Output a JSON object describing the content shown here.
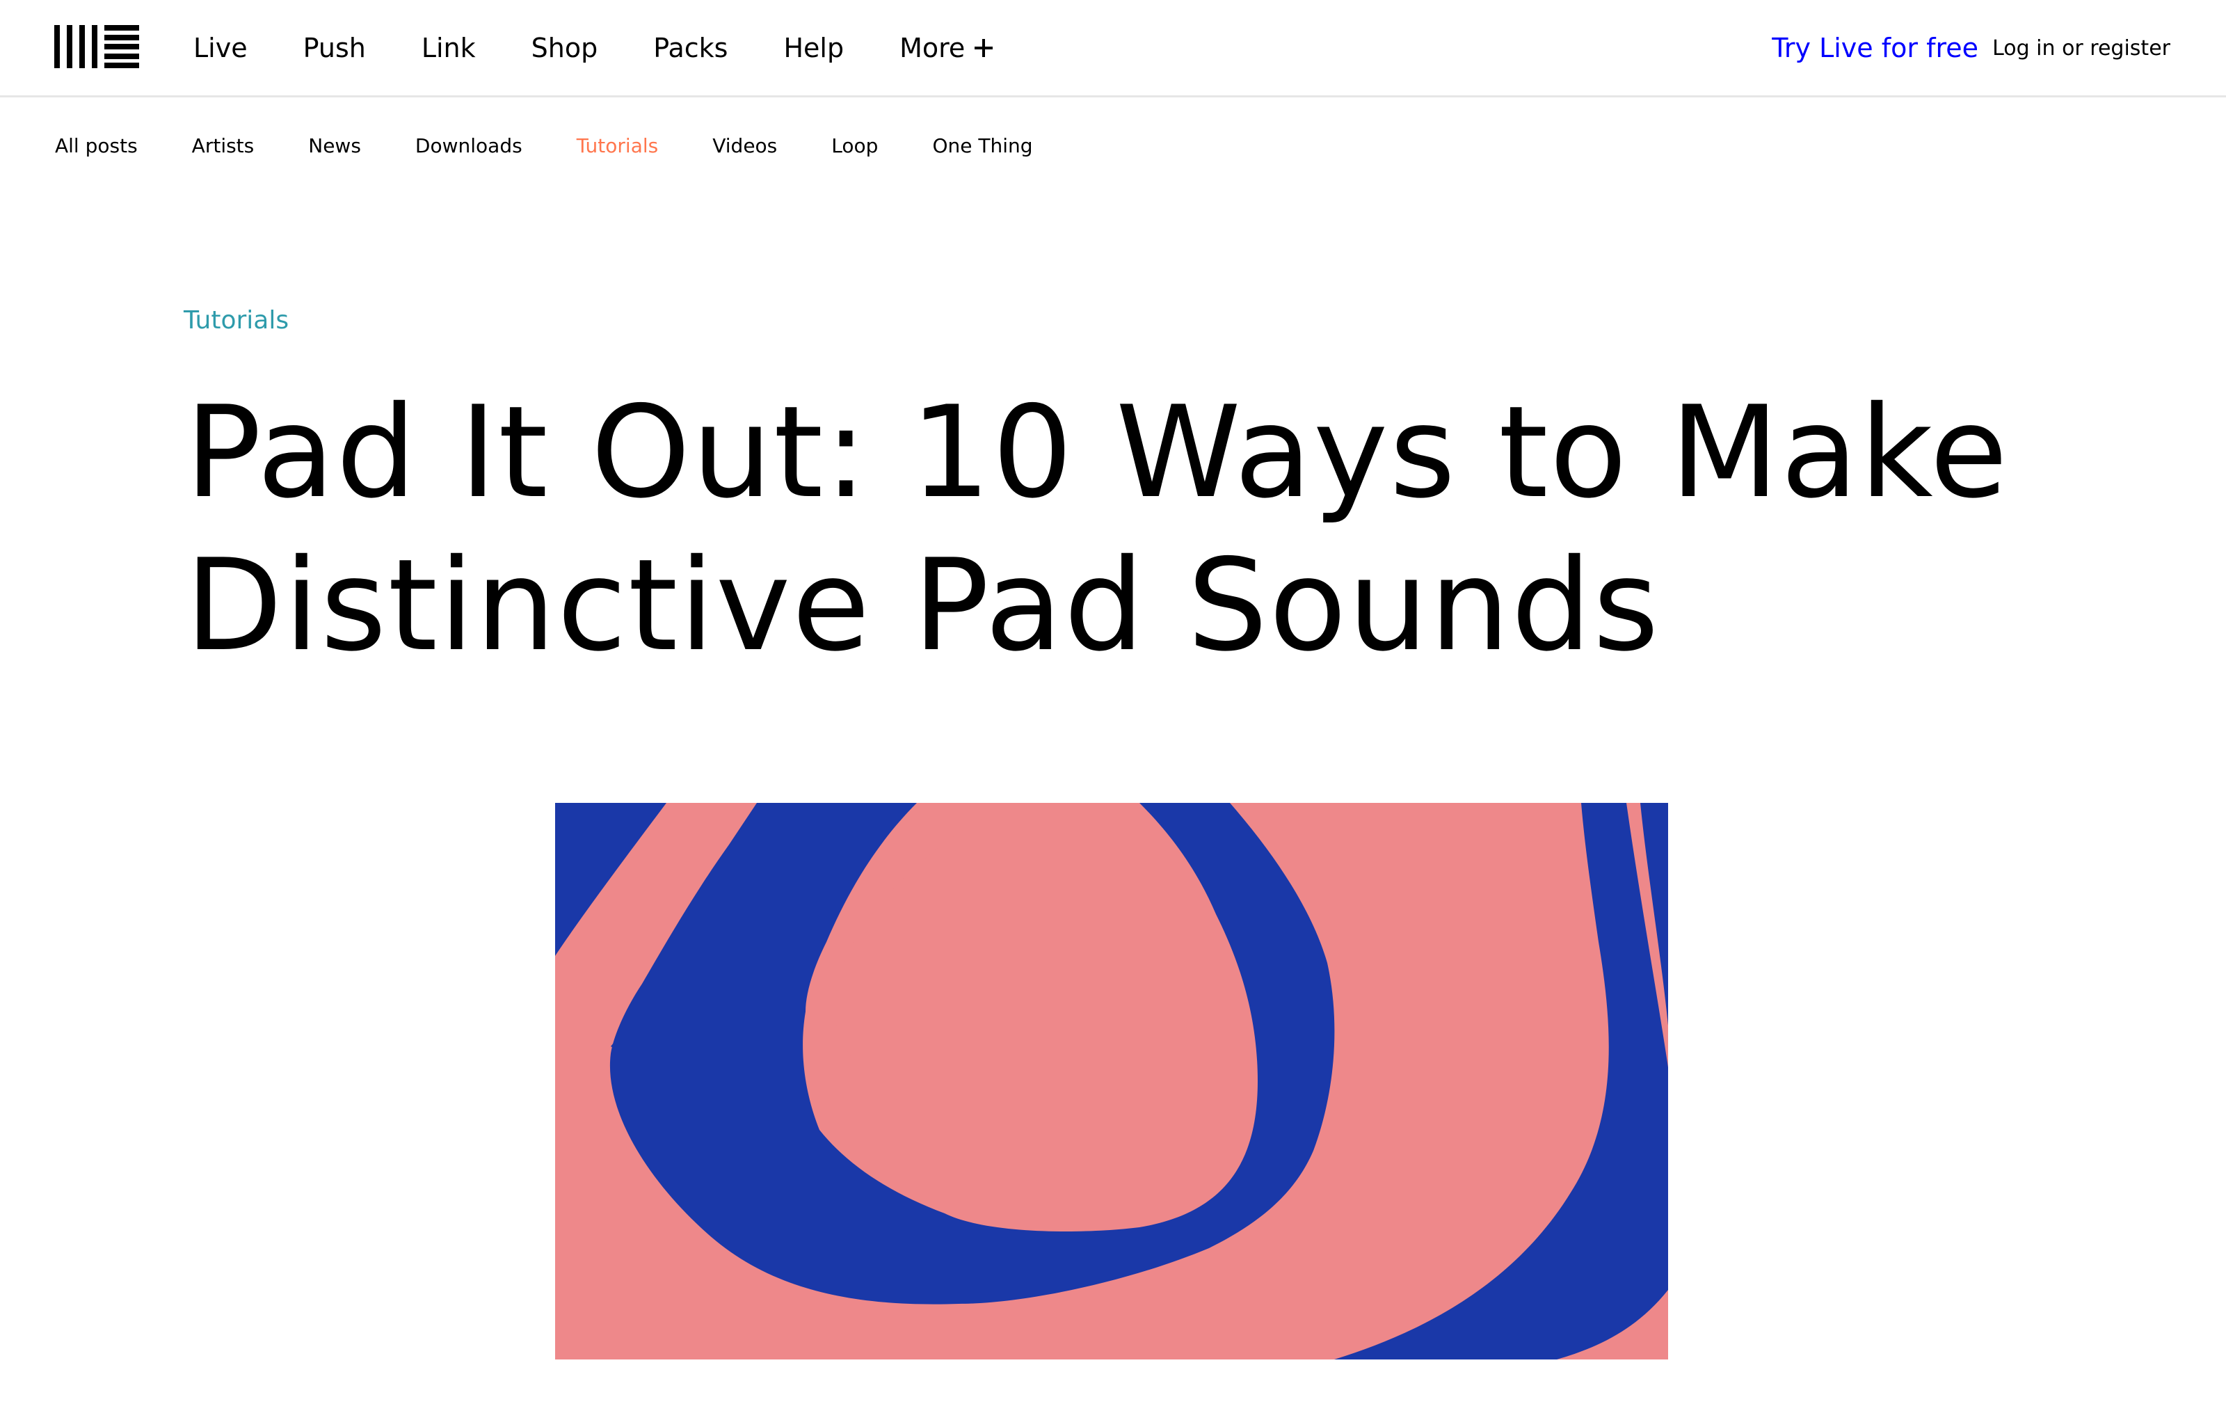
{
  "header": {
    "logo": "ableton-logo",
    "nav": [
      {
        "label": "Live"
      },
      {
        "label": "Push"
      },
      {
        "label": "Link"
      },
      {
        "label": "Shop"
      },
      {
        "label": "Packs"
      },
      {
        "label": "Help"
      },
      {
        "label": "More"
      }
    ],
    "more_icon": "plus-icon",
    "try_live_label": "Try Live for free",
    "login_label": "Log in or register"
  },
  "subnav": {
    "items": [
      {
        "label": "All posts"
      },
      {
        "label": "Artists"
      },
      {
        "label": "News"
      },
      {
        "label": "Downloads"
      },
      {
        "label": "Tutorials",
        "active": true
      },
      {
        "label": "Videos"
      },
      {
        "label": "Loop"
      },
      {
        "label": "One Thing"
      }
    ]
  },
  "article": {
    "category": "Tutorials",
    "title_line1": "Pad It Out: 10 Ways to Make",
    "title_line2": "Distinctive Pad Sounds"
  },
  "hero": {
    "image": "abstract-wavy-pattern",
    "colors": {
      "pink": "#ee888a",
      "blue": "#1a38a8"
    }
  },
  "colors": {
    "accent_blue": "#0000ff",
    "active_orange": "#ff764d",
    "category_teal": "#2e9bab"
  }
}
